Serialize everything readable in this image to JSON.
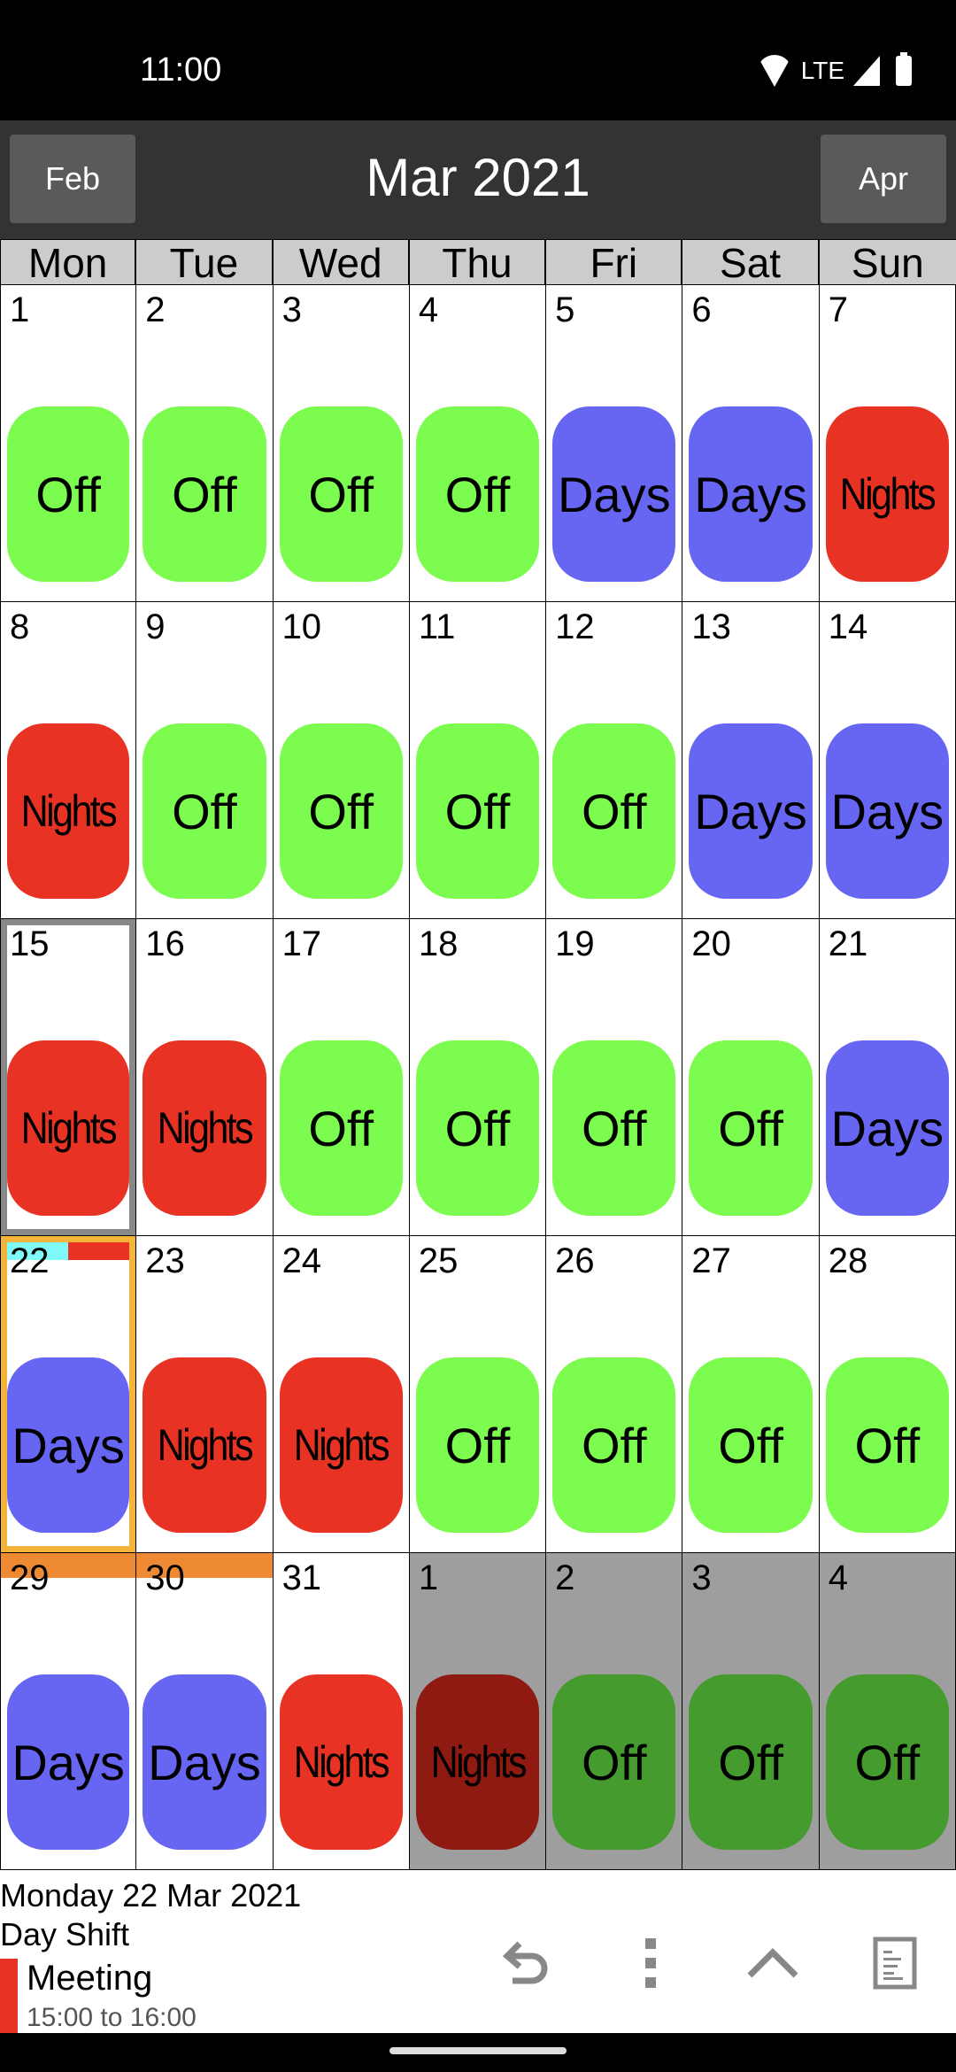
{
  "status_bar": {
    "time": "11:00",
    "network_label": "LTE",
    "icons": [
      "wifi-icon",
      "lte-icon",
      "signal-icon",
      "battery-icon"
    ]
  },
  "header": {
    "prev_label": "Feb",
    "title": "Mar 2021",
    "next_label": "Apr"
  },
  "weekdays": [
    "Mon",
    "Tue",
    "Wed",
    "Thu",
    "Fri",
    "Sat",
    "Sun"
  ],
  "shift_types": {
    "Off": {
      "color": "#7cfc4e",
      "dim_color": "#459b2e"
    },
    "Days": {
      "color": "#6666f2",
      "dim_color": "#3d3d9a"
    },
    "Nights": {
      "color": "#e83324",
      "dim_color": "#8e1a12"
    }
  },
  "days": [
    {
      "num": "1",
      "shift": "Off"
    },
    {
      "num": "2",
      "shift": "Off"
    },
    {
      "num": "3",
      "shift": "Off"
    },
    {
      "num": "4",
      "shift": "Off"
    },
    {
      "num": "5",
      "shift": "Days"
    },
    {
      "num": "6",
      "shift": "Days"
    },
    {
      "num": "7",
      "shift": "Nights"
    },
    {
      "num": "8",
      "shift": "Nights"
    },
    {
      "num": "9",
      "shift": "Off"
    },
    {
      "num": "10",
      "shift": "Off"
    },
    {
      "num": "11",
      "shift": "Off"
    },
    {
      "num": "12",
      "shift": "Off"
    },
    {
      "num": "13",
      "shift": "Days"
    },
    {
      "num": "14",
      "shift": "Days"
    },
    {
      "num": "15",
      "shift": "Nights",
      "state": "previous-selection"
    },
    {
      "num": "16",
      "shift": "Nights"
    },
    {
      "num": "17",
      "shift": "Off"
    },
    {
      "num": "18",
      "shift": "Off"
    },
    {
      "num": "19",
      "shift": "Off"
    },
    {
      "num": "20",
      "shift": "Off"
    },
    {
      "num": "21",
      "shift": "Days"
    },
    {
      "num": "22",
      "shift": "Days",
      "state": "selected",
      "event_strips": [
        "#7ff9f9",
        "#e83324"
      ]
    },
    {
      "num": "23",
      "shift": "Nights"
    },
    {
      "num": "24",
      "shift": "Nights"
    },
    {
      "num": "25",
      "shift": "Off"
    },
    {
      "num": "26",
      "shift": "Off"
    },
    {
      "num": "27",
      "shift": "Off"
    },
    {
      "num": "28",
      "shift": "Off"
    },
    {
      "num": "29",
      "shift": "Days",
      "multi_day_event": "#ed8a33"
    },
    {
      "num": "30",
      "shift": "Days",
      "multi_day_event": "#ed8a33"
    },
    {
      "num": "31",
      "shift": "Nights"
    },
    {
      "num": "1",
      "shift": "Nights",
      "other_month": true
    },
    {
      "num": "2",
      "shift": "Off",
      "other_month": true
    },
    {
      "num": "3",
      "shift": "Off",
      "other_month": true
    },
    {
      "num": "4",
      "shift": "Off",
      "other_month": true
    }
  ],
  "details": {
    "date": "Monday 22 Mar 2021",
    "shift_name": "Day Shift",
    "event": {
      "title": "Meeting",
      "time": "15:00 to 16:00",
      "color": "#e83324"
    }
  },
  "toolbar": {
    "icons": [
      "undo-icon",
      "more-vert-icon",
      "expand-up-icon",
      "notes-icon"
    ]
  }
}
